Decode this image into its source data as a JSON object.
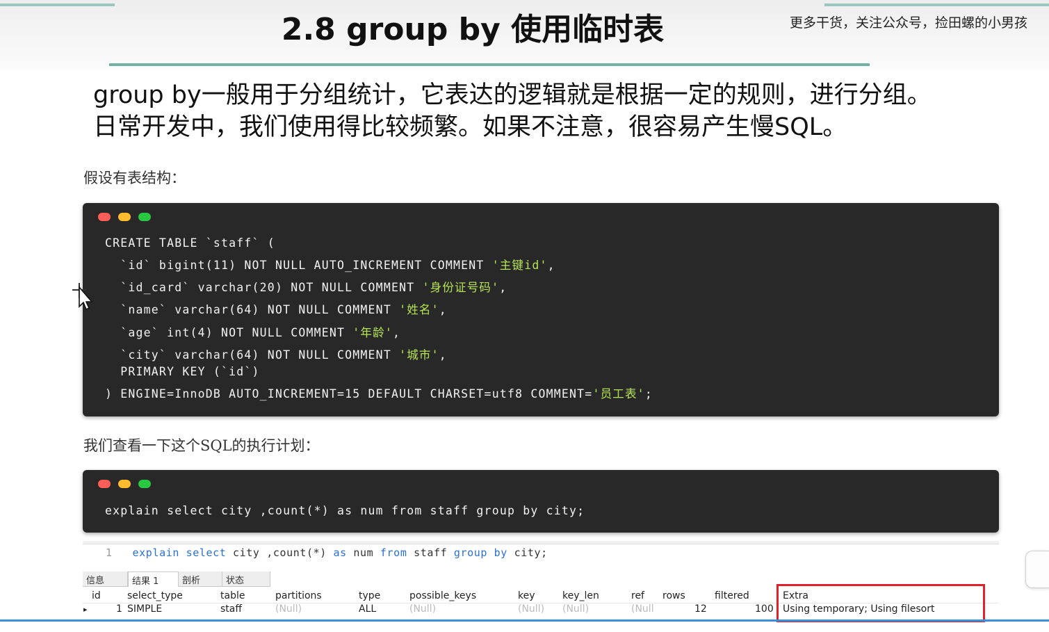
{
  "slide": {
    "title": "2.8 group by 使用临时表",
    "watermark": "更多干货，关注公众号，捡田螺的小男孩",
    "intro_lines": [
      "group by一般用于分组统计，它表达的逻辑就是根据一定的规则，进行分组。",
      "日常开发中，我们使用得比较频繁。如果不注意，很容易产生慢SQL。"
    ],
    "caption_table": "假设有表结构：",
    "caption_explain": "我们查看一下这个SQL的执行计划："
  },
  "create_table_code": {
    "line1": "CREATE TABLE `staff` (",
    "col_id_def": "  `id` bigint(11) NOT NULL AUTO_INCREMENT COMMENT ",
    "col_id_comment": "'主键id'",
    "col_idcard_def": "  `id_card` varchar(20) NOT NULL COMMENT ",
    "col_idcard_comment": "'身份证号码'",
    "col_name_def": "  `name` varchar(64) NOT NULL COMMENT ",
    "col_name_comment": "'姓名'",
    "col_age_def": "  `age` int(4) NOT NULL COMMENT ",
    "col_age_comment": "'年龄'",
    "col_city_def": "  `city` varchar(64) NOT NULL COMMENT ",
    "col_city_comment": "'城市'",
    "primary_key": "  PRIMARY KEY (`id`)",
    "engine_def": ") ENGINE=InnoDB AUTO_INCREMENT=15 DEFAULT CHARSET=utf8 COMMENT=",
    "engine_comment": "'员工表'",
    "sep_comma": ",",
    "end_semicolon": ";"
  },
  "explain_code": "explain select city ,count(*) as num from staff group by city;",
  "navicat": {
    "line_number": "1",
    "query_tokens": {
      "explain": "explain",
      "select": "select",
      "city": " city ,count(*) ",
      "as": "as",
      "num": " num ",
      "from": "from",
      "staff": " staff ",
      "group": "group",
      "by": "by",
      "end": " city;"
    },
    "tabs": [
      "信息",
      "结果 1",
      "剖析",
      "状态"
    ],
    "columns": [
      "id",
      "select_type",
      "table",
      "partitions",
      "type",
      "possible_keys",
      "key",
      "key_len",
      "ref",
      "rows",
      "filtered",
      "Extra"
    ],
    "row": {
      "marker": "▸",
      "id": "1",
      "select_type": "SIMPLE",
      "table": "staff",
      "partitions": "(Null)",
      "type": "ALL",
      "possible_keys": "(Null)",
      "key": "(Null)",
      "key_len": "(Null)",
      "ref": "(Null",
      "rows": "12",
      "filtered": "100",
      "extra": "Using temporary; Using filesort"
    }
  },
  "colors": {
    "accent_teal": "#6fb3a7",
    "code_bg": "#282828",
    "code_string": "#b6e354",
    "sql_keyword": "#2a6fd6",
    "highlight_red": "#e0202a",
    "dot_red": "#ff5f57",
    "dot_yellow": "#febc2e",
    "dot_green": "#28c840"
  }
}
